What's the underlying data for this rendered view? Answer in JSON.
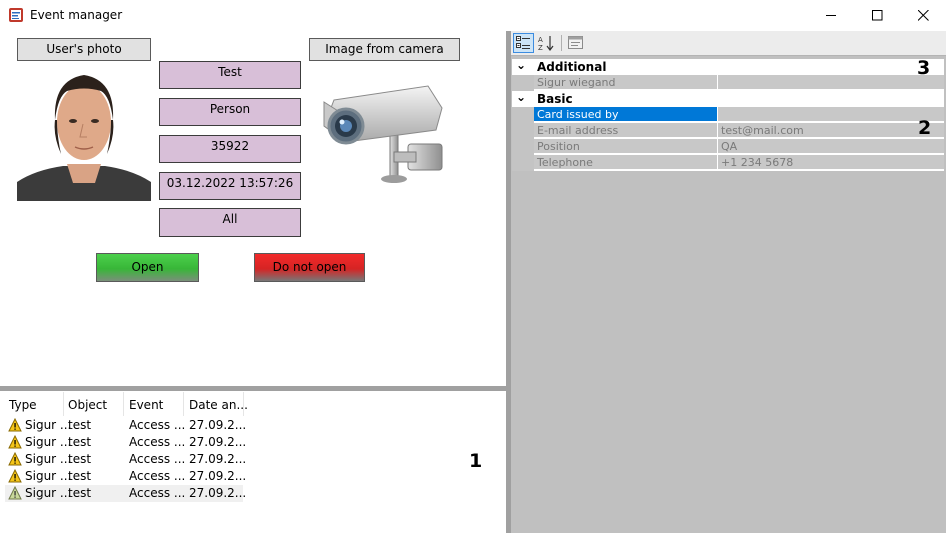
{
  "window": {
    "title": "Event manager",
    "minimize_glyph": "─",
    "maximize_glyph": "☐",
    "close_glyph": "✕"
  },
  "event_card": {
    "photo_label": "User's photo",
    "camera_label": "Image from camera",
    "fields": [
      "Test",
      "Person",
      "35922",
      "03.12.2022 13:57:26",
      "All"
    ],
    "open_button": "Open",
    "do_not_open_button": "Do not open"
  },
  "event_list": {
    "columns": [
      "Type",
      "Object",
      "Event",
      "Date an..."
    ],
    "rows": [
      {
        "type": "Sigur ...",
        "object": "test",
        "event": "Access ...",
        "date": "27.09.2..."
      },
      {
        "type": "Sigur ...",
        "object": "test",
        "event": "Access ...",
        "date": "27.09.2..."
      },
      {
        "type": "Sigur ...",
        "object": "test",
        "event": "Access ...",
        "date": "27.09.2..."
      },
      {
        "type": "Sigur ...",
        "object": "test",
        "event": "Access ...",
        "date": "27.09.2..."
      },
      {
        "type": "Sigur ...",
        "object": "test",
        "event": "Access ...",
        "date": "27.09.2..."
      }
    ]
  },
  "property_grid": {
    "categories": [
      {
        "name": "Additional",
        "chevron": "⌄"
      },
      {
        "name": "Basic",
        "chevron": "⌄"
      }
    ],
    "additional_rows": [
      {
        "name": "Sigur wiegand",
        "value": ""
      }
    ],
    "basic_rows": [
      {
        "name": "Card issued by",
        "value": ""
      },
      {
        "name": "E-mail address",
        "value": "test@mail.com"
      },
      {
        "name": "Position",
        "value": "QA"
      },
      {
        "name": "Telephone",
        "value": "+1 234 5678"
      }
    ],
    "selected_row": "Card issued by"
  },
  "callouts": [
    "1",
    "2",
    "3"
  ],
  "colors": {
    "field_bg": "#d8bfd8",
    "open_green": "#38b638",
    "deny_red": "#d62424",
    "selection_blue": "#0078d7",
    "splitter_gray": "#a0a0a0",
    "grid_row_gray": "#c8c8c8"
  },
  "icons": [
    "event-manager-app-icon",
    "user-photo",
    "security-camera-icon",
    "warning-icon",
    "categorized-view-icon",
    "alphabetical-sort-icon",
    "property-pages-icon"
  ]
}
